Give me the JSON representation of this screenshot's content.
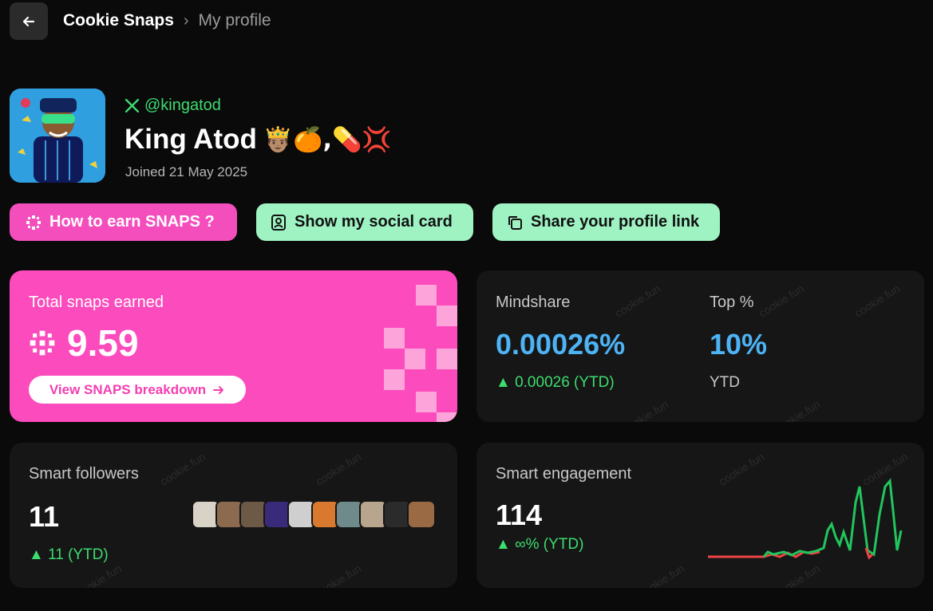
{
  "header": {
    "back_icon": "arrow-left-icon",
    "breadcrumb_root": "Cookie Snaps",
    "breadcrumb_sep": "›",
    "breadcrumb_current": "My profile"
  },
  "profile": {
    "handle": "@kingatod",
    "name": "King Atod",
    "name_emoji": "🤴🏽🍊,💊💢",
    "joined": "Joined 21 May 2025"
  },
  "actions": {
    "earn_label": "How to earn SNAPS ?",
    "social_label": "Show my social card",
    "share_label": "Share your profile link"
  },
  "snaps": {
    "label": "Total snaps earned",
    "value": "9.59",
    "breakdown_label": "View SNAPS breakdown"
  },
  "mindshare": {
    "label": "Mindshare",
    "value": "0.00026%",
    "delta": "▲ 0.00026 (YTD)",
    "top_label": "Top %",
    "top_value": "10%",
    "top_sub": "YTD"
  },
  "followers": {
    "label": "Smart followers",
    "value": "11",
    "delta": "▲ 11 (YTD)",
    "avatar_colors": [
      "#d9d2c7",
      "#8b6a4f",
      "#6c5a46",
      "#3a2a7a",
      "#cfcfcf",
      "#d9782f",
      "#6f8a8a",
      "#b7a58d",
      "#2b2b2b",
      "#9a6a45"
    ]
  },
  "engagement": {
    "label": "Smart engagement",
    "value": "114",
    "delta": "▲ ∞% (YTD)",
    "colors": {
      "up": "#22c55e",
      "down": "#ef4444"
    }
  },
  "watermark": "cookie.fun"
}
